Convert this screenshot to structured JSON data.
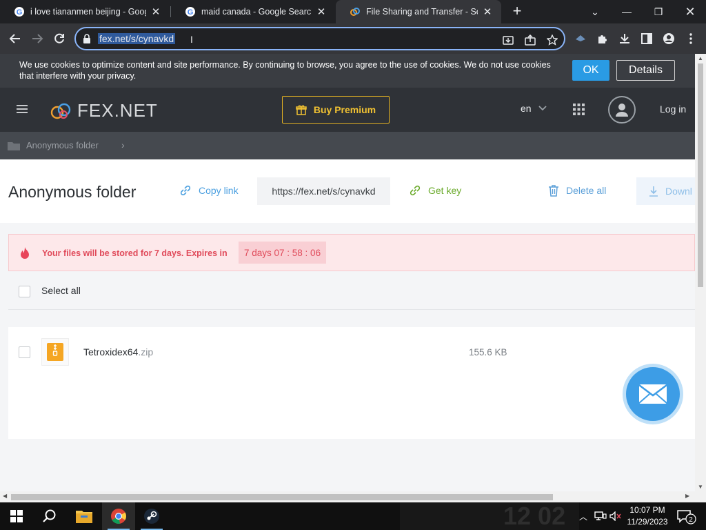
{
  "browser": {
    "tabs": [
      {
        "title": "i love tiananmen beijing - Google",
        "active": false
      },
      {
        "title": "maid canada - Google Search",
        "active": false
      },
      {
        "title": "File Sharing and Transfer - Send",
        "active": true
      }
    ],
    "url": "fex.net/s/cynavkd"
  },
  "cookie_banner": {
    "message": "We use cookies to optimize content and site performance. By continuing to browse, you agree to the use of cookies. We do not use cookies that interfere with your privacy.",
    "ok_label": "OK",
    "details_label": "Details"
  },
  "site_header": {
    "logo_text": "FEX.NET",
    "premium_label": "Buy Premium",
    "language": "en",
    "login_label": "Log in"
  },
  "breadcrumb": {
    "folder_label": "Anonymous folder"
  },
  "folder": {
    "title": "Anonymous folder",
    "copy_link_label": "Copy link",
    "link_value": "https://fex.net/s/cynavkd",
    "get_key_label": "Get key",
    "delete_all_label": "Delete all",
    "download_label": "Downl"
  },
  "expiry": {
    "message": "Your files will be stored for 7 days. Expires in",
    "countdown": "7 days  07 : 58 : 06"
  },
  "select_all_label": "Select all",
  "files": [
    {
      "name": "Tetroxidex64",
      "ext": ".zip",
      "size": "155.6 KB"
    }
  ],
  "taskbar": {
    "time": "10:07 PM",
    "date": "11/29/2023",
    "notification_count": "2",
    "wallpaper_text": "12 02"
  },
  "colors": {
    "accent": "#2a9be4",
    "premium": "#f1c232",
    "danger": "#e04a5a",
    "getkey": "#6aaa2a"
  }
}
